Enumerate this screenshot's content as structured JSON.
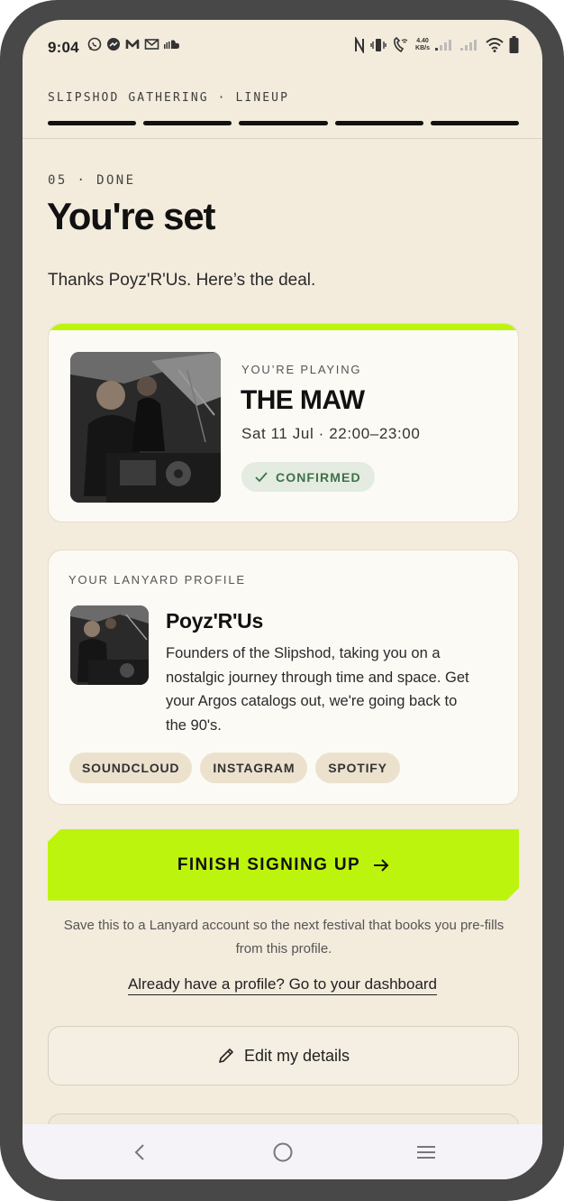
{
  "status_bar": {
    "time": "9:04",
    "left_icons": [
      "whatsapp-icon",
      "messenger-icon",
      "m-app-icon",
      "gmail-icon",
      "soundcloud-icon"
    ],
    "right_icons": [
      "nfc-icon",
      "vibrate-icon",
      "wifi-calling-icon",
      "signal-icon",
      "signal-icon",
      "wifi-icon",
      "battery-icon"
    ],
    "net_speed_value": "4.40",
    "net_speed_unit": "KB/s"
  },
  "header": {
    "eyebrow": "SLIPSHOD GATHERING · LINEUP",
    "progress_steps": 5,
    "progress_complete": 5
  },
  "page": {
    "step": "05 · DONE",
    "title": "You're set",
    "thanks": "Thanks Poyz'R'Us. Here’s the deal."
  },
  "slot": {
    "label": "YOU’RE PLAYING",
    "stage": "THE MAW",
    "time": "Sat 11 Jul · 22:00–23:00",
    "status": "CONFIRMED"
  },
  "profile": {
    "label": "YOUR LANYARD PROFILE",
    "name": "Poyz'R'Us",
    "bio": "Founders of the Slipshod, taking you on a nostalgic journey through time and space. Get your Argos catalogs out, we're going back to the 90's.",
    "links": [
      "SOUNDCLOUD",
      "INSTAGRAM",
      "SPOTIFY"
    ]
  },
  "actions": {
    "finish_label": "FINISH SIGNING UP",
    "save_note": "Save this to a Lanyard account so the next festival that books you pre-fills from this profile.",
    "dashboard_link": "Already have a profile? Go to your dashboard",
    "edit_label": "Edit my details"
  },
  "colors": {
    "background": "#f3ebdc",
    "accent": "#bdf40e",
    "confirmed_text": "#3d7248",
    "confirmed_bg": "#e4ebe0"
  }
}
